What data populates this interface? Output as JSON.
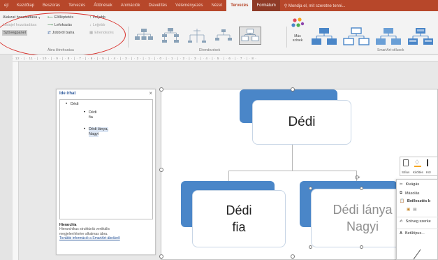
{
  "tabs": [
    {
      "label": "ejl"
    },
    {
      "label": "Kezdőlap"
    },
    {
      "label": "Beszúrás"
    },
    {
      "label": "Tervezés"
    },
    {
      "label": "Áttűnések"
    },
    {
      "label": "Animációk"
    },
    {
      "label": "Diavetítés"
    },
    {
      "label": "Véleményezés"
    },
    {
      "label": "Nézet"
    },
    {
      "label": "Tervezés",
      "state": "active"
    },
    {
      "label": "Formátum"
    }
  ],
  "tell_me": "Mondja el, mit szeretne tenni...",
  "ribbon": {
    "create_graphic": {
      "add_shape": "Alakzat hozzáadása",
      "add_bullet": "Listajel hozzáadása",
      "text_pane": "Szövegpanel",
      "promote": "Előléptetés",
      "demote": "Lefokozás",
      "right_to_left": "Jobbról balra",
      "move_up": "Feljebb",
      "move_down": "Lejjebb",
      "layout": "Elrendezés",
      "group_label": "Ábra létrehozása"
    },
    "layouts_label": "Elrendezések",
    "colors_label_1": "Más",
    "colors_label_2": "színek",
    "styles_label": "SmartArt-stílusok"
  },
  "ruler_text": "· 12 · | · 11 · | · 10 · | · 9 · | · 8 · | · 7 · | · 6 · | · 5 · | · 4 · | · 3 · | · 2 · | · 1 · | · 0 · | · 1 · | · 2 · | · 3 · | · 4 · | · 5 · | · 6 · | · 7 · | · 8 ·",
  "text_pane": {
    "title": "Ide írhat",
    "close": "×",
    "items": [
      "Dédi",
      "Dédi",
      "fia",
      "Dédi lánya,",
      "Nagyi"
    ],
    "footer_title": "Hierarchia",
    "footer_text_1": "Hierarchikus struktúrák vertikális",
    "footer_text_2": "megjelenítésére alkalmas ábra.",
    "footer_link": "További információ a SmartArt-ábrákról"
  },
  "diagram": {
    "top": "Dédi",
    "left_1": "Dédi",
    "left_2": "fia",
    "right_1": "Dédi lánya",
    "right_2": "Nagyi"
  },
  "mini_toolbar": {
    "style": "Stílus",
    "fill": "Kitöltés",
    "outline": "Kör"
  },
  "context_menu": {
    "cut": "Kivágás",
    "copy": "Másolás",
    "paste_options": "Beillesztés b",
    "text_edit": "Szöveg szerke",
    "font": "Betűtípus..."
  },
  "colors": {
    "accent": "#b7472a",
    "node_blue": "#4a86c8",
    "annotation_red": "#d9302b"
  }
}
